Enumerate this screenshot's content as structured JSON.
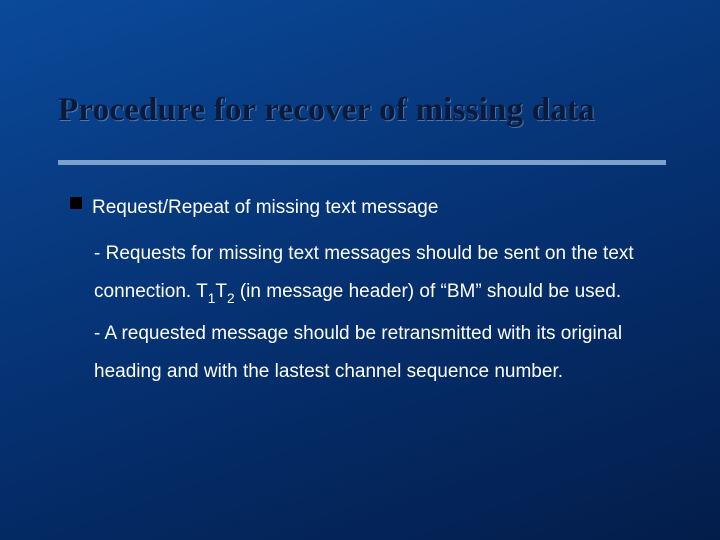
{
  "title": "Procedure for recover of missing data",
  "bullet": {
    "heading": "Request/Repeat of missing text message",
    "para1_pre": "‐ Requests for missing text messages should be sent on the text connection.  T",
    "para1_s1": "1",
    "para1_mid": "T",
    "para1_s2": "2",
    "para1_post": "  (in message header) of “BM” should be used.",
    "para2": "‐ A requested message should be retransmitted with its original heading and with the lastest channel sequence number."
  }
}
